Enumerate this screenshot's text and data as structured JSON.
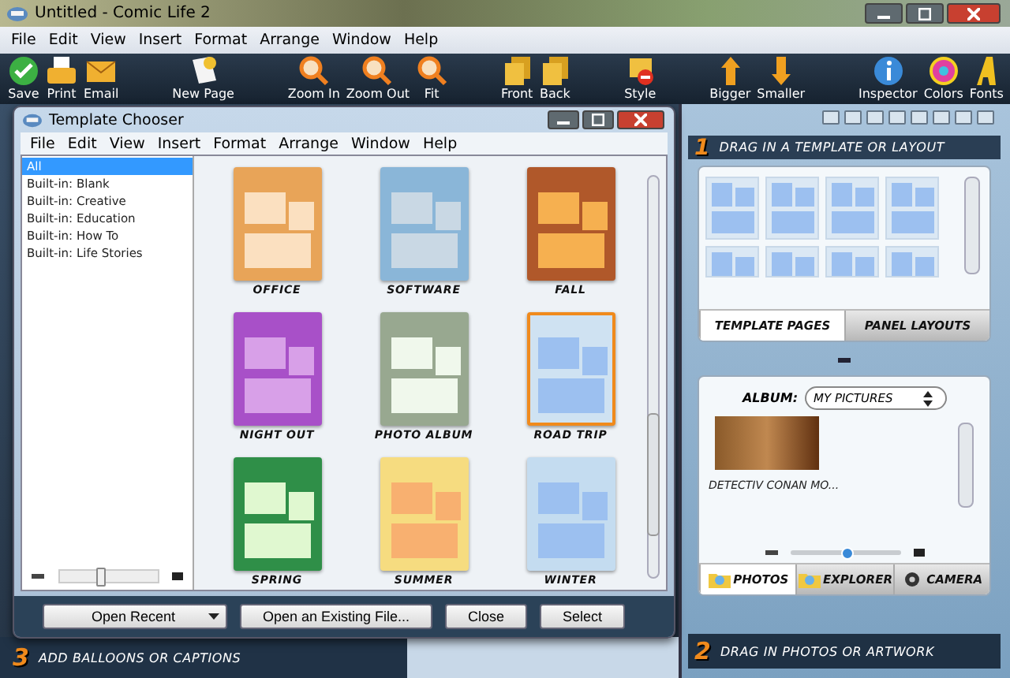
{
  "window": {
    "title": "Untitled - Comic Life 2"
  },
  "menu": [
    "File",
    "Edit",
    "View",
    "Insert",
    "Format",
    "Arrange",
    "Window",
    "Help"
  ],
  "toolbar_groups": [
    [
      "Save",
      "Print",
      "Email"
    ],
    [
      "New Page"
    ],
    [
      "Zoom In",
      "Zoom Out",
      "Fit"
    ],
    [
      "Front",
      "Back"
    ],
    [
      "Style"
    ],
    [
      "Bigger",
      "Smaller"
    ],
    [
      "Inspector",
      "Colors",
      "Fonts"
    ]
  ],
  "canvas": {
    "step": "3",
    "caption": "ADD BALLOONS OR CAPTIONS"
  },
  "template_chooser": {
    "title": "Template Chooser",
    "menu": [
      "File",
      "Edit",
      "View",
      "Insert",
      "Format",
      "Arrange",
      "Window",
      "Help"
    ],
    "categories": [
      {
        "label": "All",
        "selected": true
      },
      {
        "label": "Built-in: Blank",
        "selected": false
      },
      {
        "label": "Built-in: Creative",
        "selected": false
      },
      {
        "label": "Built-in: Education",
        "selected": false
      },
      {
        "label": "Built-in: How  To",
        "selected": false
      },
      {
        "label": "Built-in: Life Stories",
        "selected": false
      }
    ],
    "size_slider": {
      "level": 0.45
    },
    "templates": [
      {
        "name": "OFFICE",
        "selected": false
      },
      {
        "name": "SOFTWARE",
        "selected": false
      },
      {
        "name": "FALL",
        "selected": false
      },
      {
        "name": "NIGHT OUT",
        "selected": false
      },
      {
        "name": "PHOTO ALBUM",
        "selected": false
      },
      {
        "name": "ROAD TRIP",
        "selected": true
      },
      {
        "name": "SPRING",
        "selected": false
      },
      {
        "name": "SUMMER",
        "selected": false
      },
      {
        "name": "WINTER",
        "selected": false
      }
    ],
    "buttons": {
      "open_recent": "Open Recent",
      "open_file": "Open an Existing File...",
      "close": "Close",
      "select": "Select"
    }
  },
  "template_panel": {
    "step": "1",
    "title": "DRAG IN A TEMPLATE OR LAYOUT",
    "tabs": [
      {
        "label": "TEMPLATE PAGES",
        "selected": true
      },
      {
        "label": "PANEL LAYOUTS",
        "selected": false
      }
    ]
  },
  "photo_panel": {
    "album_label": "ALBUM:",
    "album": "MY PICTURES",
    "photo_caption": "DETECTIV CONAN MO...",
    "size_slider": {
      "level": 0.52
    },
    "tabs": [
      {
        "label": "PHOTOS",
        "selected": true
      },
      {
        "label": "EXPLORER",
        "selected": false
      },
      {
        "label": "CAMERA",
        "selected": false
      }
    ],
    "step": "2",
    "title": "DRAG IN PHOTOS OR ARTWORK"
  }
}
